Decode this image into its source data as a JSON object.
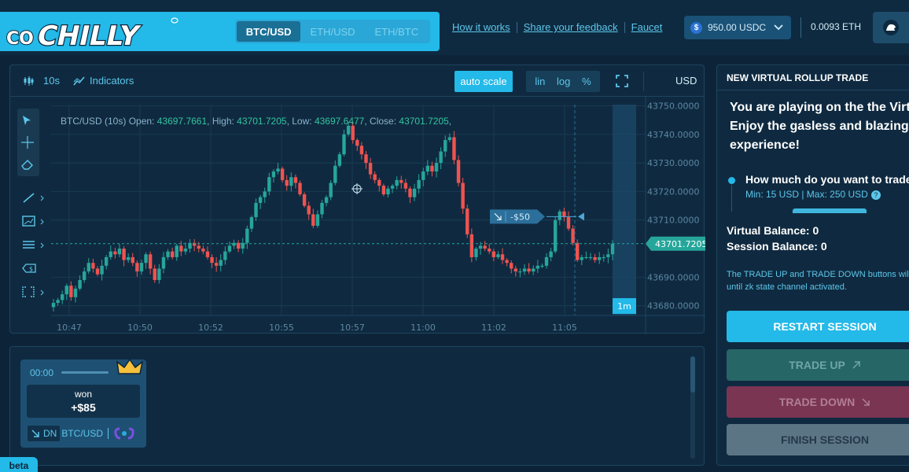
{
  "header": {
    "logo_text": "CoCHILLY",
    "pairs": [
      {
        "label": "BTC/USD",
        "active": true
      },
      {
        "label": "ETH/USD",
        "active": false
      },
      {
        "label": "ETH/BTC",
        "active": false
      }
    ],
    "nav": [
      {
        "label": "How it works"
      },
      {
        "label": "Share your feedback"
      },
      {
        "label": "Faucet"
      }
    ],
    "wallet_balance": "950.00 USDC",
    "wallet_coin_icon": "usdc-coin-icon",
    "eth_balance": "0.0093 ETH",
    "avatar_icon": "user-avatar-icon"
  },
  "chart_toolbar": {
    "interval": "10s",
    "indicators_label": "Indicators",
    "auto_scale_label": "auto scale",
    "scale_options": [
      "lin",
      "log",
      "%"
    ],
    "currency": "USD"
  },
  "chart_data": {
    "type": "candlestick",
    "legend": {
      "pair": "BTC/USD (10s)",
      "open_label": "Open:",
      "open": "43697.7661",
      "high_label": "High:",
      "high": "43701.7205",
      "low_label": "Low:",
      "low": "43697.6477",
      "close_label": "Close:",
      "close": "43701.7205"
    },
    "y_ticks": [
      "43750.0000",
      "43740.0000",
      "43730.0000",
      "43720.0000",
      "43710.0000",
      "43690.0000",
      "43680.0000"
    ],
    "y_tick_values": [
      43750,
      43740,
      43730,
      43720,
      43710,
      43690,
      43680
    ],
    "x_ticks": [
      "10:47",
      "10:50",
      "10:52",
      "10:55",
      "10:57",
      "11:00",
      "11:02",
      "11:05"
    ],
    "ylim": [
      43676.6,
      43750.4
    ],
    "current_price": 43701.7205,
    "current_price_label": "43701.7205",
    "interval_badge": "1m",
    "bet_marker": {
      "label": "-$50",
      "price": 43711.2
    },
    "grid": true,
    "up_color": "#26a69a",
    "down_color": "#ef5350",
    "close": [
      43681,
      43682,
      43684,
      43687,
      43683,
      43686,
      43689,
      43692,
      43695,
      43693,
      43691,
      43694,
      43697,
      43699,
      43698,
      43700,
      43696,
      43697,
      43695,
      43692,
      43695,
      43698,
      43693,
      43689,
      43693,
      43697,
      43699,
      43697,
      43701,
      43699,
      43700,
      43702,
      43701,
      43700,
      43699,
      43697,
      43695,
      43694,
      43696,
      43699,
      43701,
      43702,
      43700,
      43702,
      43707,
      43711,
      43716,
      43718,
      43720,
      43725,
      43727,
      43728,
      43724,
      43722,
      43725,
      43723,
      43719,
      43715,
      43712,
      43708,
      43712,
      43716,
      43718,
      43723,
      43729,
      43733,
      43740,
      43743,
      43738,
      43736,
      43733,
      43730,
      43726,
      43724,
      43722,
      43719,
      43721,
      43722,
      43724,
      43723,
      43721,
      43718,
      43721,
      43724,
      43727,
      43729,
      43727,
      43730,
      43734,
      43738,
      43739,
      43731,
      43723,
      43714,
      43705,
      43697,
      43700,
      43701,
      43700,
      43699,
      43697,
      43698,
      43696,
      43695,
      43693,
      43692,
      43692,
      43693,
      43692,
      43693,
      43694,
      43694,
      43697,
      43699,
      43710,
      43713,
      43711,
      43707,
      43702,
      43696,
      43697,
      43697,
      43697,
      43696,
      43697,
      43697,
      43698,
      43701.7205
    ]
  },
  "drawing_tools": [
    "cursor-icon",
    "crosshair-icon",
    "eraser-icon",
    "trend-line-icon",
    "rectangle-icon",
    "parallel-lines-icon",
    "price-label-icon",
    "range-icon"
  ],
  "positions": [
    {
      "time": "00:00",
      "status": "won",
      "amount": "+$85",
      "direction": "DN",
      "pair": "BTC/USD",
      "badge_icon": "crown-icon",
      "share_icon": "share-icon"
    }
  ],
  "beta_label": "beta",
  "trade_panel": {
    "header": "NEW VIRTUAL ROLLUP TRADE",
    "welcome_lines": [
      "You are playing on the the Virtual Rollup.",
      "Enjoy the gasless and blazing fast",
      "experience!"
    ],
    "step_question": "How much do you want to trade?",
    "step_range": "Min: 15 USD | Max: 250 USD",
    "virtual_balance": "Virtual Balance: 0",
    "session_balance": "Session Balance: 0",
    "note_lines": [
      "The TRADE UP and TRADE DOWN buttons will be",
      "until zk state channel activated."
    ],
    "restart_label": "RESTART SESSION",
    "up_label": "TRADE UP",
    "down_label": "TRADE DOWN",
    "finish_label": "FINISH SESSION",
    "colors": {
      "accent": "#23b9e8",
      "up_disabled": "#276667",
      "down_disabled": "#7a3553",
      "finish": "#5c7585"
    }
  }
}
